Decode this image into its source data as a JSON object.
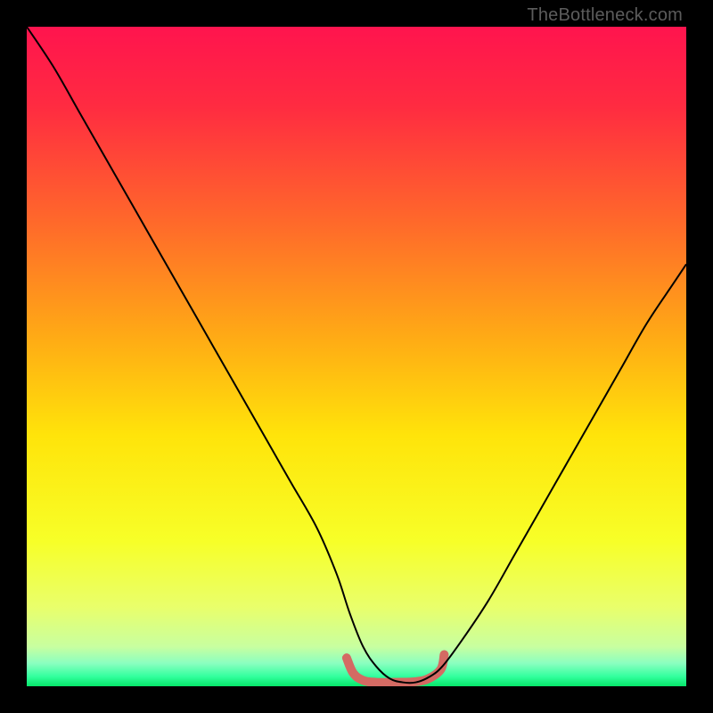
{
  "watermark": "TheBottleneck.com",
  "chart_data": {
    "type": "line",
    "title": "",
    "xlabel": "",
    "ylabel": "",
    "xlim": [
      0,
      100
    ],
    "ylim": [
      0,
      100
    ],
    "background_gradient_stops": [
      {
        "pos": 0.0,
        "color": "#ff144e"
      },
      {
        "pos": 0.12,
        "color": "#ff2b41"
      },
      {
        "pos": 0.3,
        "color": "#ff6a2a"
      },
      {
        "pos": 0.48,
        "color": "#ffae14"
      },
      {
        "pos": 0.62,
        "color": "#ffe40a"
      },
      {
        "pos": 0.78,
        "color": "#f7ff28"
      },
      {
        "pos": 0.88,
        "color": "#e9ff6b"
      },
      {
        "pos": 0.94,
        "color": "#c8ffa0"
      },
      {
        "pos": 0.965,
        "color": "#8bffc0"
      },
      {
        "pos": 0.985,
        "color": "#33ff9e"
      },
      {
        "pos": 1.0,
        "color": "#06e66a"
      }
    ],
    "series": [
      {
        "name": "bottleneck-curve",
        "stroke": "#000000",
        "stroke_width": 2,
        "x": [
          0,
          4,
          8,
          12,
          16,
          20,
          24,
          28,
          32,
          36,
          40,
          44,
          47,
          49,
          51,
          53,
          55,
          57,
          59,
          61,
          63,
          66,
          70,
          74,
          78,
          82,
          86,
          90,
          94,
          98,
          100
        ],
        "y": [
          100,
          94,
          87,
          80,
          73,
          66,
          59,
          52,
          45,
          38,
          31,
          24,
          17,
          11,
          6,
          3,
          1.2,
          0.6,
          0.6,
          1.4,
          3,
          7,
          13,
          20,
          27,
          34,
          41,
          48,
          55,
          61,
          64
        ]
      },
      {
        "name": "sweet-spot-marker",
        "stroke": "#d46a63",
        "stroke_width": 10,
        "linecap": "round",
        "x": [
          48.5,
          49.5,
          51,
          53,
          56,
          59,
          61,
          62.8,
          63.3
        ],
        "y": [
          4.3,
          2.0,
          0.9,
          0.6,
          0.6,
          0.7,
          1.2,
          2.6,
          4.8
        ]
      }
    ]
  }
}
